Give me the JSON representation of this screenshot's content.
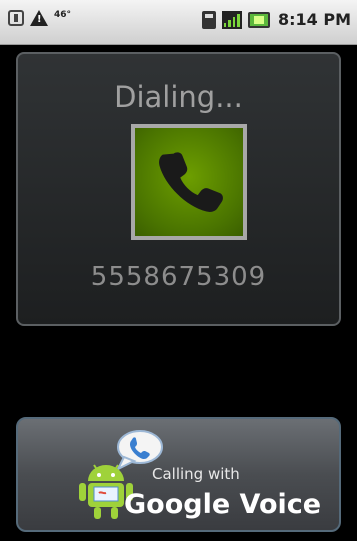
{
  "status_bar": {
    "temperature": "46°",
    "time": "8:14 PM"
  },
  "call": {
    "status": "Dialing...",
    "number": "5558675309"
  },
  "voice_button": {
    "line1": "Calling with",
    "line2": "Google Voice"
  },
  "colors": {
    "phone_icon_bg": "#4a7400",
    "card_bg": "#262829",
    "button_bg": "#4a4d51"
  },
  "icons": [
    "usb-icon",
    "warning-icon",
    "sd-card-icon",
    "signal-icon",
    "battery-icon",
    "phone-handset-icon",
    "android-icon",
    "speech-bubble-icon"
  ]
}
